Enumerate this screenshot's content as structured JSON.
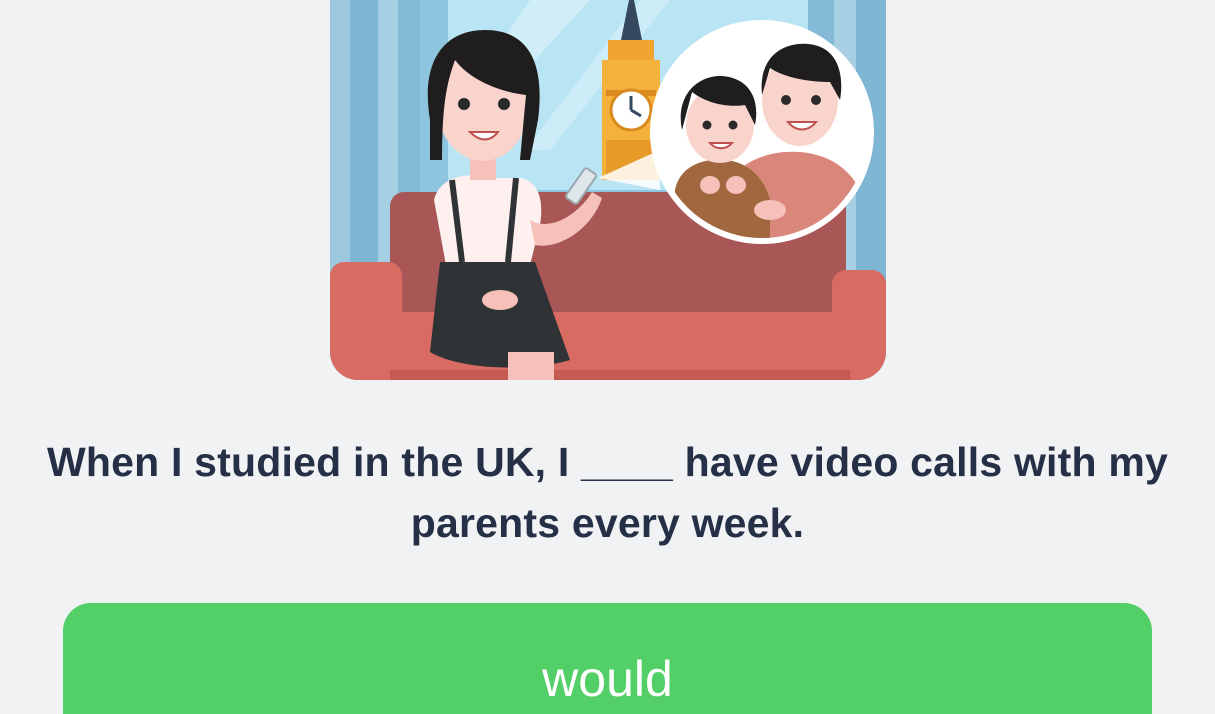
{
  "question": {
    "text": "When I studied in the UK, I ____ have video calls with my parents every week."
  },
  "options": [
    {
      "label": "would",
      "state": "correct",
      "color": "#53cf67"
    }
  ],
  "colors": {
    "background": "#f1f2f4",
    "question_text": "#253047",
    "accent_green": "#53cf67"
  },
  "illustration": {
    "icon": "video-call-scene-illustration"
  }
}
